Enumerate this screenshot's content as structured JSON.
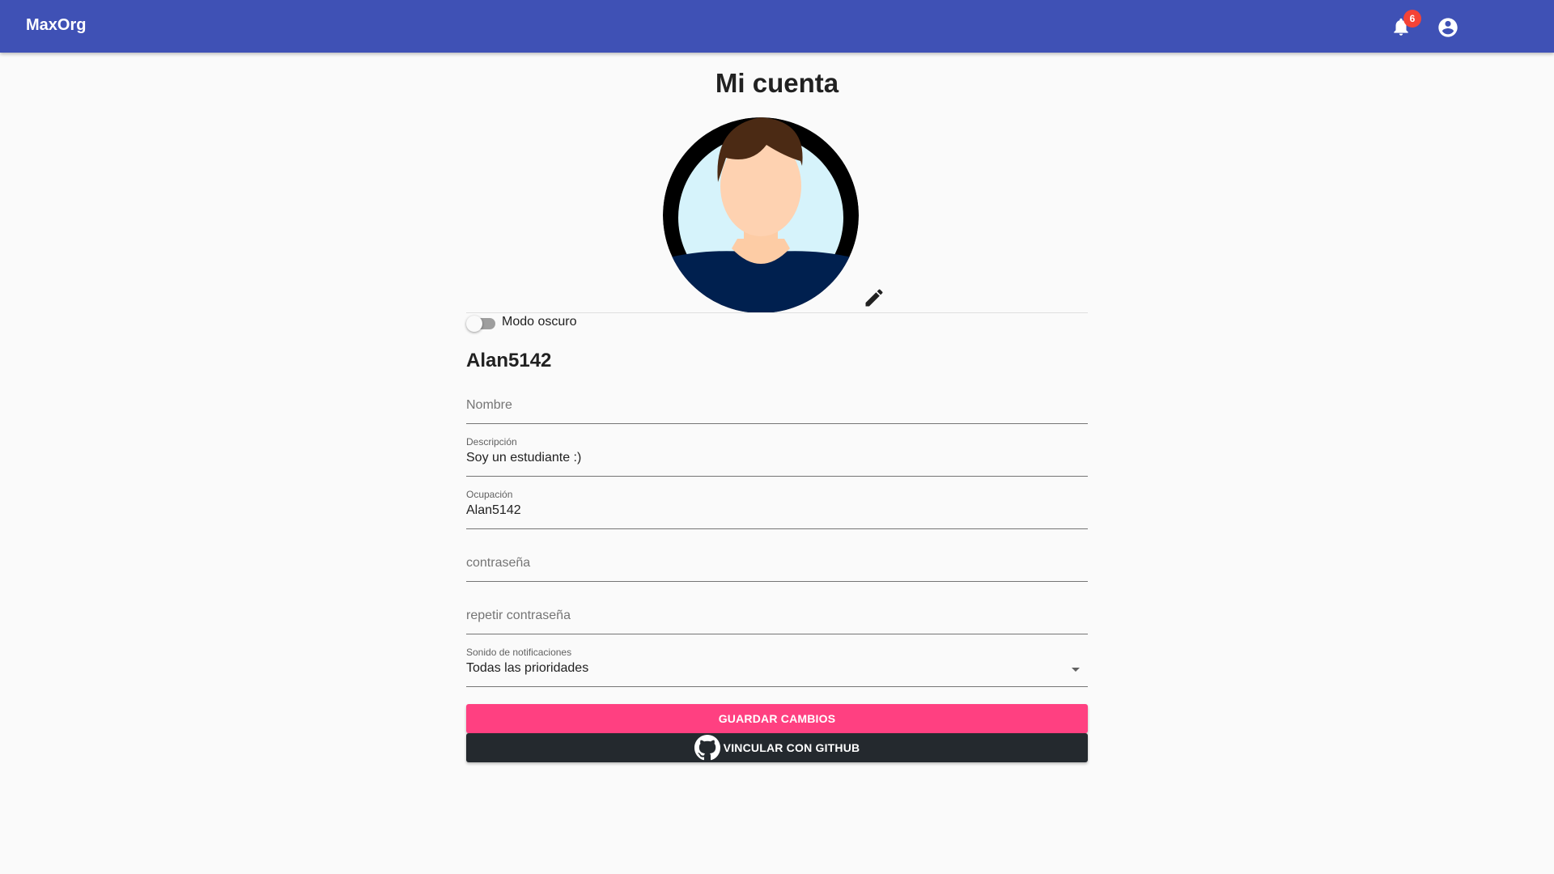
{
  "appbar": {
    "brand": "MaxOrg",
    "notification_count": "6",
    "color": "#3f51b5"
  },
  "page": {
    "title": "Mi cuenta",
    "username": "Alan5142"
  },
  "dark_mode": {
    "label": "Modo oscuro",
    "enabled": false
  },
  "form": {
    "nombre": {
      "placeholder": "Nombre",
      "value": ""
    },
    "descripcion": {
      "label": "Descripción",
      "value": "Soy un estudiante :)"
    },
    "ocupacion": {
      "label": "Ocupación",
      "value": "Alan5142"
    },
    "password": {
      "placeholder": "contraseña",
      "value": ""
    },
    "password_repeat": {
      "placeholder": "repetir contraseña",
      "value": ""
    },
    "notification_sound": {
      "label": "Sonido de notificaciones",
      "selected": "Todas las prioridades"
    }
  },
  "buttons": {
    "save": "GUARDAR CAMBIOS",
    "github": "VINCULAR CON GITHUB"
  },
  "colors": {
    "accent": "#ff4081",
    "github": "#24292e"
  }
}
